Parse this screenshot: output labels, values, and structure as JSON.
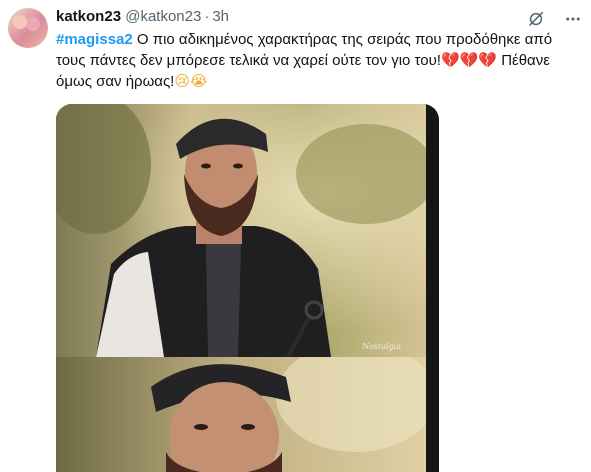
{
  "tweet": {
    "display_name": "katkon23",
    "handle": "@katkon23",
    "separator": "·",
    "time": "3h",
    "hashtag": "#magissa2",
    "text_main": " Ο πιο αδικημένος χαρακτήρας της σειράς που προδόθηκε από τους πάντες δεν μπόρεσε τελικά να χαρεί ούτε τον γιο του!",
    "emoji_hearts": [
      "💔",
      "💔",
      "💔"
    ],
    "text_end": " Πέθανε όμως σαν ήρωας!",
    "emoji_faces": [
      "😢",
      "😭"
    ],
    "media_watermark": "Nostalgia"
  },
  "icons": {
    "grok": "grok-icon",
    "more": "more-icon",
    "avatar": "avatar"
  },
  "colors": {
    "hashtag": "#1d9bf0",
    "secondary_text": "#536471",
    "primary_text": "#0f1419",
    "heart": "#e0245e"
  }
}
